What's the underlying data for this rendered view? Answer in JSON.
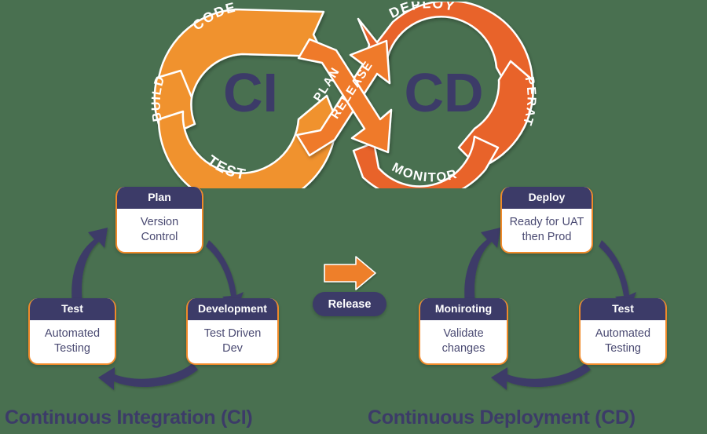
{
  "colors": {
    "background": "#497050",
    "navy": "#3c3b68",
    "orange_light": "#f0922e",
    "orange_dark": "#e8642a",
    "card_border": "#f08a2a",
    "white": "#ffffff"
  },
  "loop": {
    "ci_label": "CI",
    "cd_label": "CD",
    "ci_stages": [
      "CODE",
      "BUILD",
      "TEST"
    ],
    "cd_stages": [
      "DEPLOY",
      "OPERATE",
      "MONITOR"
    ],
    "cross_stages": [
      "PLAN",
      "RELEASE"
    ]
  },
  "ci_group": {
    "title": "Continuous Integration (CI)",
    "cards": [
      {
        "id": "plan",
        "header": "Plan",
        "body": "Version\nControl",
        "body_lines": [
          "Version",
          "Control"
        ]
      },
      {
        "id": "development",
        "header": "Development",
        "body": "Test Driven\nDev",
        "body_lines": [
          "Test Driven",
          "Dev"
        ]
      },
      {
        "id": "test",
        "header": "Test",
        "body": "Automated\nTesting",
        "body_lines": [
          "Automated",
          "Testing"
        ]
      }
    ]
  },
  "cd_group": {
    "title": "Continuous Deployment (CD)",
    "cards": [
      {
        "id": "deploy",
        "header": "Deploy",
        "body": "Ready for UAT\nthen Prod",
        "body_lines": [
          "Ready for UAT",
          "then Prod"
        ]
      },
      {
        "id": "test",
        "header": "Test",
        "body": "Automated\nTesting",
        "body_lines": [
          "Automated",
          "Testing"
        ]
      },
      {
        "id": "moniroting",
        "header": "Moniroting",
        "body": "Validate\nchanges",
        "body_lines": [
          "Validate",
          "changes"
        ]
      }
    ]
  },
  "connector": {
    "label": "Release",
    "arrow_icon": "right-arrow-icon"
  }
}
